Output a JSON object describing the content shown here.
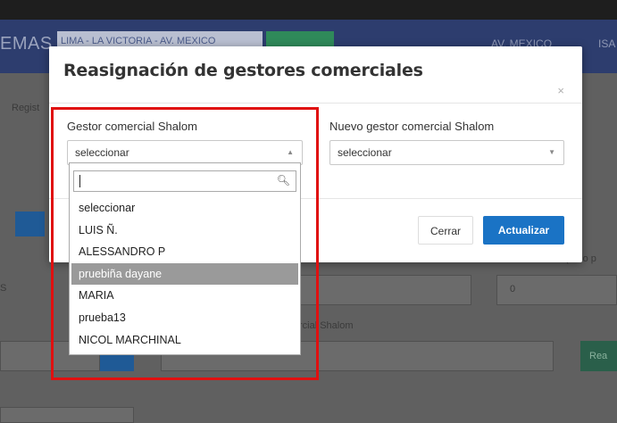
{
  "navbar": {
    "brand": "EMAS",
    "location_select": "LIMA - LA VICTORIA - AV. MEXICO",
    "right_text_1": "AV. MEXICO",
    "right_text_2": "ISA"
  },
  "background": {
    "breadcrumb": "Regist",
    "label_right": "Días de crédito (Solo p",
    "label_mid": "rcial Shalom",
    "number_value": "0",
    "partial_button": "Rea",
    "partial_s": "S"
  },
  "modal": {
    "title": "Reasignación de gestores comerciales",
    "close": "×",
    "field1_label": "Gestor comercial Shalom",
    "field1_value": "seleccionar",
    "field2_label": "Nuevo gestor comercial Shalom",
    "field2_value": "seleccionar",
    "btn_close": "Cerrar",
    "btn_update": "Actualizar"
  },
  "dropdown": {
    "search_value": "",
    "options": [
      "seleccionar",
      "LUIS Ñ.",
      "ALESSANDRO P",
      "pruebiña dayane",
      "MARIA",
      "prueba13",
      "NICOL MARCHINAL"
    ],
    "highlighted": "pruebiña dayane"
  },
  "colors": {
    "accent": "#1a73c5",
    "highlight_box": "#e01010"
  }
}
